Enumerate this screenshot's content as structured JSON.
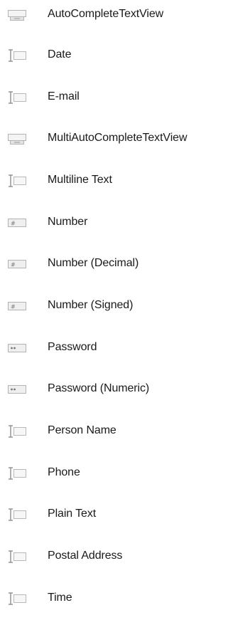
{
  "palette": {
    "items": [
      {
        "label": "AutoCompleteTextView",
        "icon": "autocomplete-icon"
      },
      {
        "label": "Date",
        "icon": "text-cursor-icon"
      },
      {
        "label": "E-mail",
        "icon": "text-cursor-icon"
      },
      {
        "label": "MultiAutoCompleteTextView",
        "icon": "autocomplete-icon"
      },
      {
        "label": "Multiline Text",
        "icon": "text-cursor-icon"
      },
      {
        "label": "Number",
        "icon": "number-field-icon"
      },
      {
        "label": "Number (Decimal)",
        "icon": "number-field-icon"
      },
      {
        "label": "Number (Signed)",
        "icon": "number-field-icon"
      },
      {
        "label": "Password",
        "icon": "password-field-icon"
      },
      {
        "label": "Password (Numeric)",
        "icon": "password-field-icon"
      },
      {
        "label": "Person Name",
        "icon": "text-cursor-icon"
      },
      {
        "label": "Phone",
        "icon": "text-cursor-icon"
      },
      {
        "label": "Plain Text",
        "icon": "text-cursor-icon"
      },
      {
        "label": "Postal Address",
        "icon": "text-cursor-icon"
      },
      {
        "label": "Time",
        "icon": "text-cursor-icon"
      }
    ]
  }
}
